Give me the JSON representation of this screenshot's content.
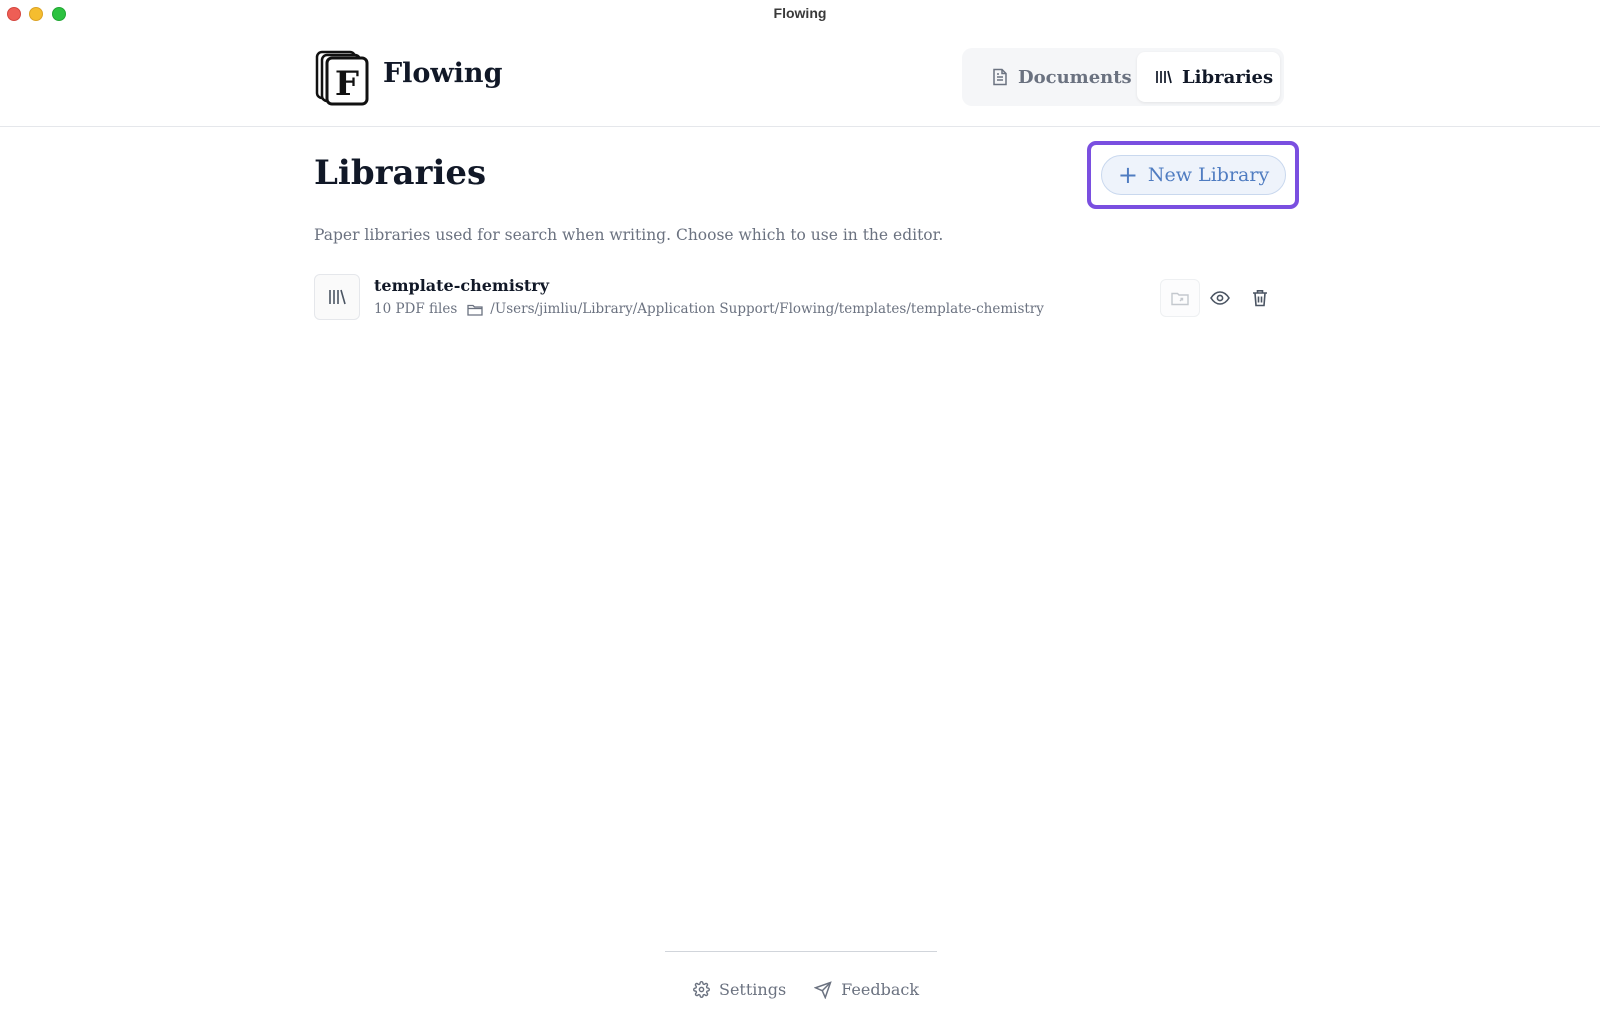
{
  "window": {
    "title": "Flowing"
  },
  "header": {
    "brand_name": "Flowing",
    "logo_letter": "F",
    "tabs": [
      {
        "label": "Documents",
        "icon": "document-icon",
        "active": false
      },
      {
        "label": "Libraries",
        "icon": "library-icon",
        "active": true
      }
    ]
  },
  "main": {
    "title": "Libraries",
    "new_library_label": "New Library",
    "description": "Paper libraries used for search when writing. Choose which to use in the editor.",
    "libraries": [
      {
        "name": "template-chemistry",
        "file_count": "10 PDF files",
        "path": "/Users/jimliu/Library/Application Support/Flowing/templates/template-chemistry"
      }
    ]
  },
  "footer": {
    "settings_label": "Settings",
    "feedback_label": "Feedback"
  },
  "colors": {
    "accent": "#4f7cc1",
    "highlight": "#7a4fe0",
    "text_primary": "#111827",
    "text_muted": "#6b7280"
  }
}
